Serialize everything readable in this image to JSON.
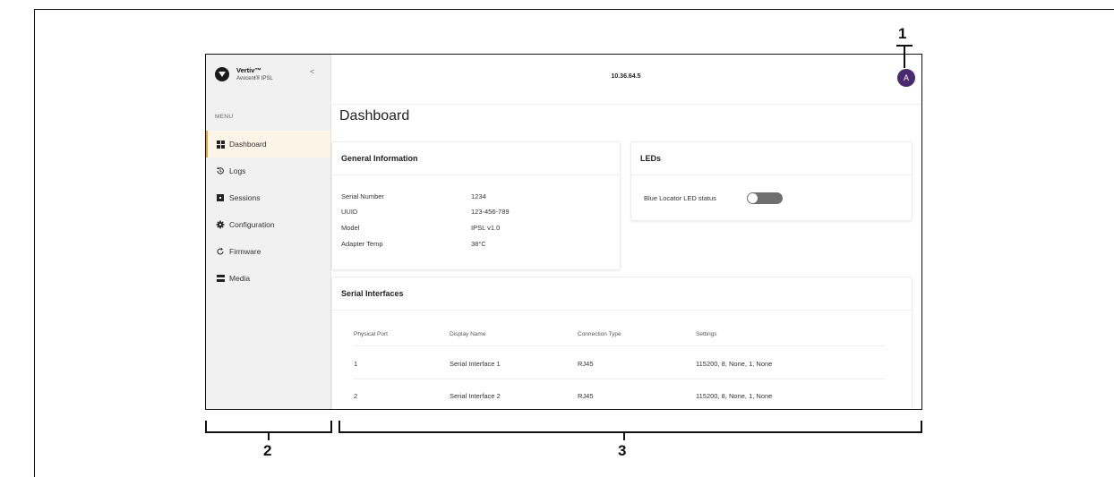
{
  "callouts": {
    "topbar": "1",
    "sidebar": "2",
    "content": "3"
  },
  "sidebar": {
    "brand_name": "Vertiv™",
    "brand_sub": "Avocent® IPSL",
    "collapse_glyph": "<",
    "menu_heading": "MENU",
    "items": [
      {
        "label": "Dashboard",
        "icon": "dashboard-grid-icon",
        "active": true
      },
      {
        "label": "Logs",
        "icon": "history-icon",
        "active": false
      },
      {
        "label": "Sessions",
        "icon": "sessions-square-icon",
        "active": false
      },
      {
        "label": "Configuration",
        "icon": "gear-icon",
        "active": false
      },
      {
        "label": "Firmware",
        "icon": "refresh-icon",
        "active": false
      },
      {
        "label": "Media",
        "icon": "media-drive-icon",
        "active": false
      }
    ]
  },
  "header": {
    "ip": "10.36.64.5",
    "avatar_initial": "A",
    "avatar_color": "#4a2a6e"
  },
  "main": {
    "title": "Dashboard",
    "general_info": {
      "title": "General Information",
      "rows": [
        {
          "label": "Serial Number",
          "value": "1234"
        },
        {
          "label": "UUID",
          "value": "123-456-789"
        },
        {
          "label": "Model",
          "value": "IPSL v1.0"
        },
        {
          "label": "Adapter Temp",
          "value": "38°C"
        }
      ]
    },
    "leds": {
      "title": "LEDs",
      "blue_locator_label": "Blue Locator LED status",
      "blue_locator_on": false
    },
    "serial_interfaces": {
      "title": "Serial Interfaces",
      "columns": [
        "Physical Port",
        "Display Name",
        "Connection Type",
        "Settings"
      ],
      "rows": [
        [
          "1",
          "Serial Interface 1",
          "RJ45",
          "115200, 8, None, 1, None"
        ],
        [
          "2",
          "Serial Interface 2",
          "RJ45",
          "115200, 8, None, 1, None"
        ]
      ]
    }
  },
  "colors": {
    "accent": "#e6a33c",
    "active_bg": "#fcf4e6",
    "sidebar_bg": "#f1f1f1"
  }
}
